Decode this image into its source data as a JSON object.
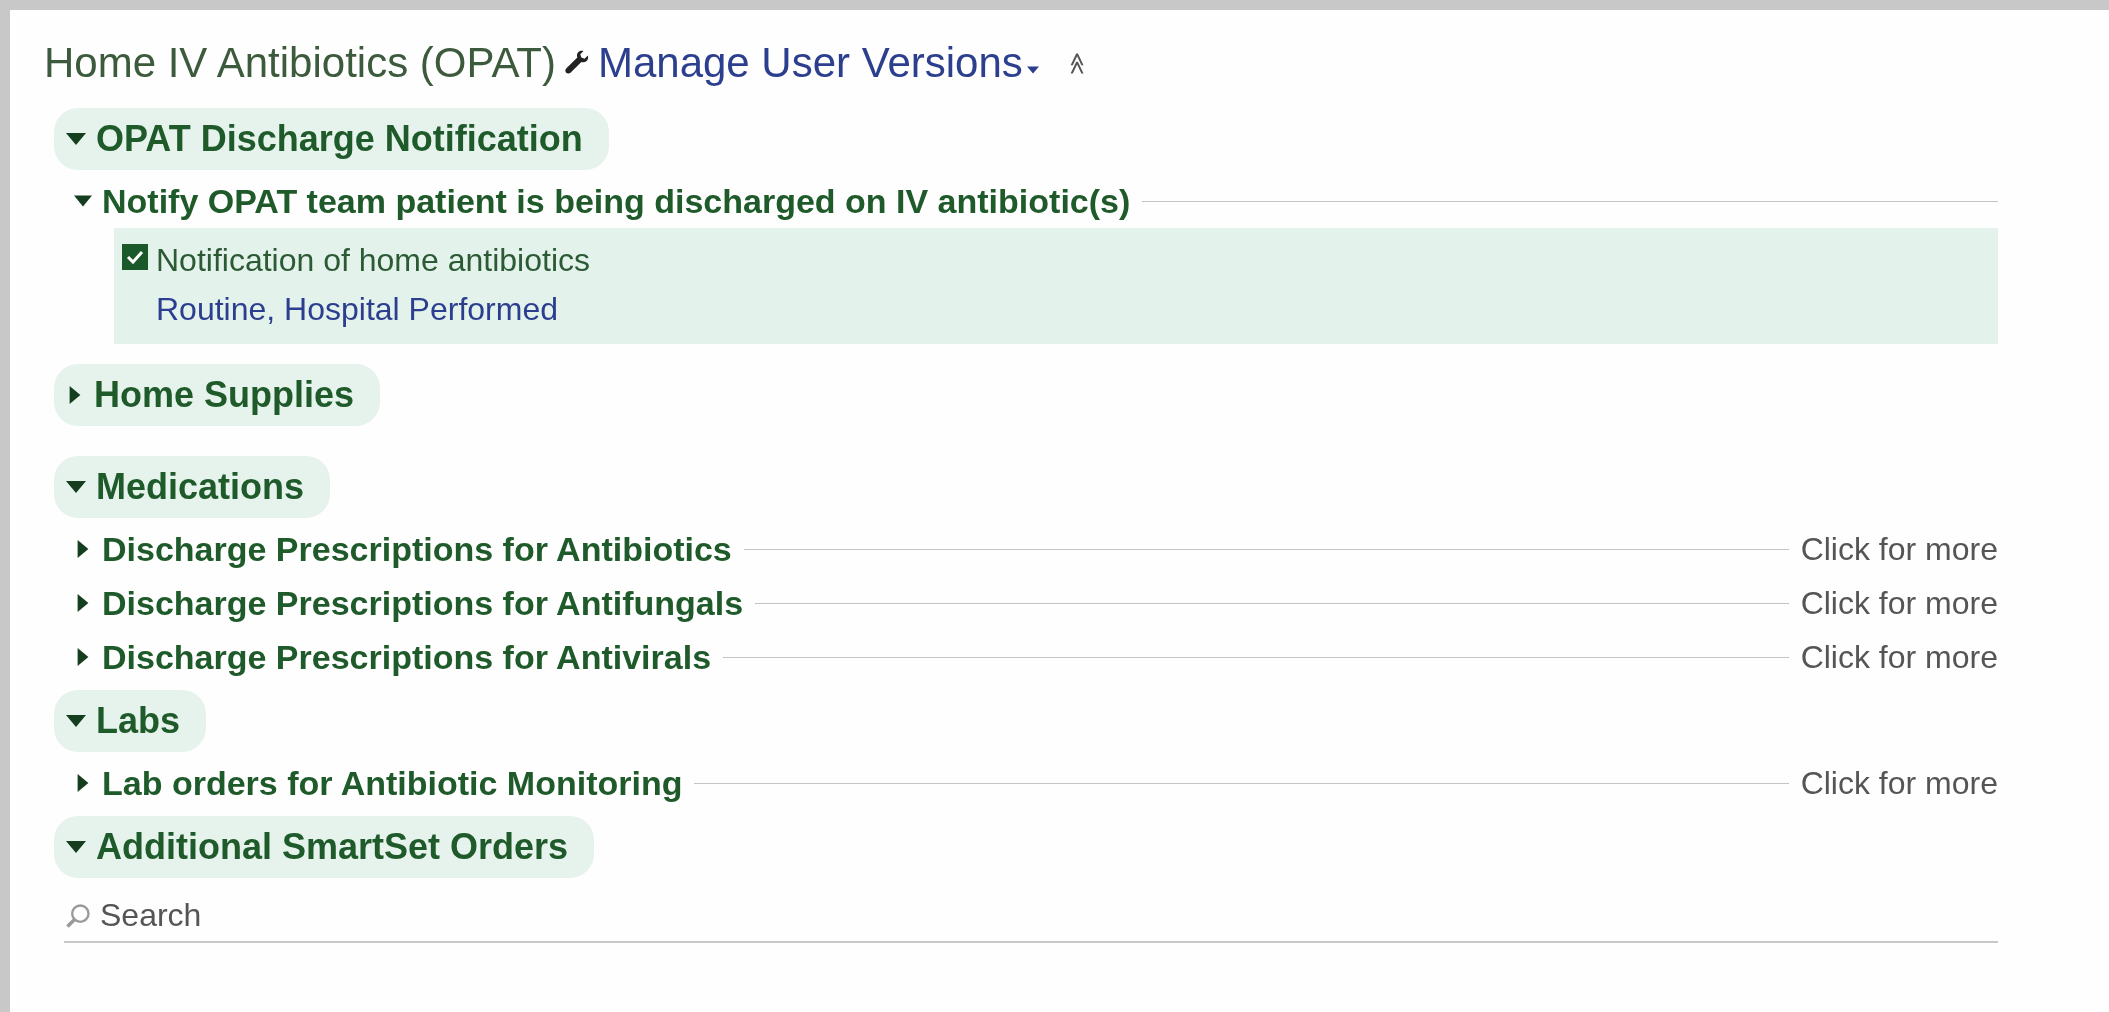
{
  "header": {
    "title": "Home IV Antibiotics (OPAT)",
    "manage_link": "Manage User Versions",
    "collapse_icon": "≫"
  },
  "sections": [
    {
      "label": "OPAT Discharge Notification",
      "expanded": true,
      "groups": [
        {
          "label": "Notify OPAT team patient is being discharged on IV antibiotic(s)",
          "expanded": true,
          "items": [
            {
              "label": "Notification of home antibiotics",
              "detail": "Routine, Hospital Performed",
              "checked": true
            }
          ]
        }
      ]
    },
    {
      "label": "Home Supplies",
      "expanded": false
    },
    {
      "label": "Medications",
      "expanded": true,
      "groups": [
        {
          "label": "Discharge Prescriptions for Antibiotics",
          "expanded": false,
          "more": "Click for more"
        },
        {
          "label": "Discharge Prescriptions for Antifungals",
          "expanded": false,
          "more": "Click for more"
        },
        {
          "label": "Discharge Prescriptions for Antivirals",
          "expanded": false,
          "more": "Click for more"
        }
      ]
    },
    {
      "label": "Labs",
      "expanded": true,
      "groups": [
        {
          "label": "Lab orders for Antibiotic Monitoring",
          "expanded": false,
          "more": "Click for more"
        }
      ]
    },
    {
      "label": "Additional SmartSet Orders",
      "expanded": true
    }
  ],
  "search": {
    "placeholder": "Search"
  }
}
